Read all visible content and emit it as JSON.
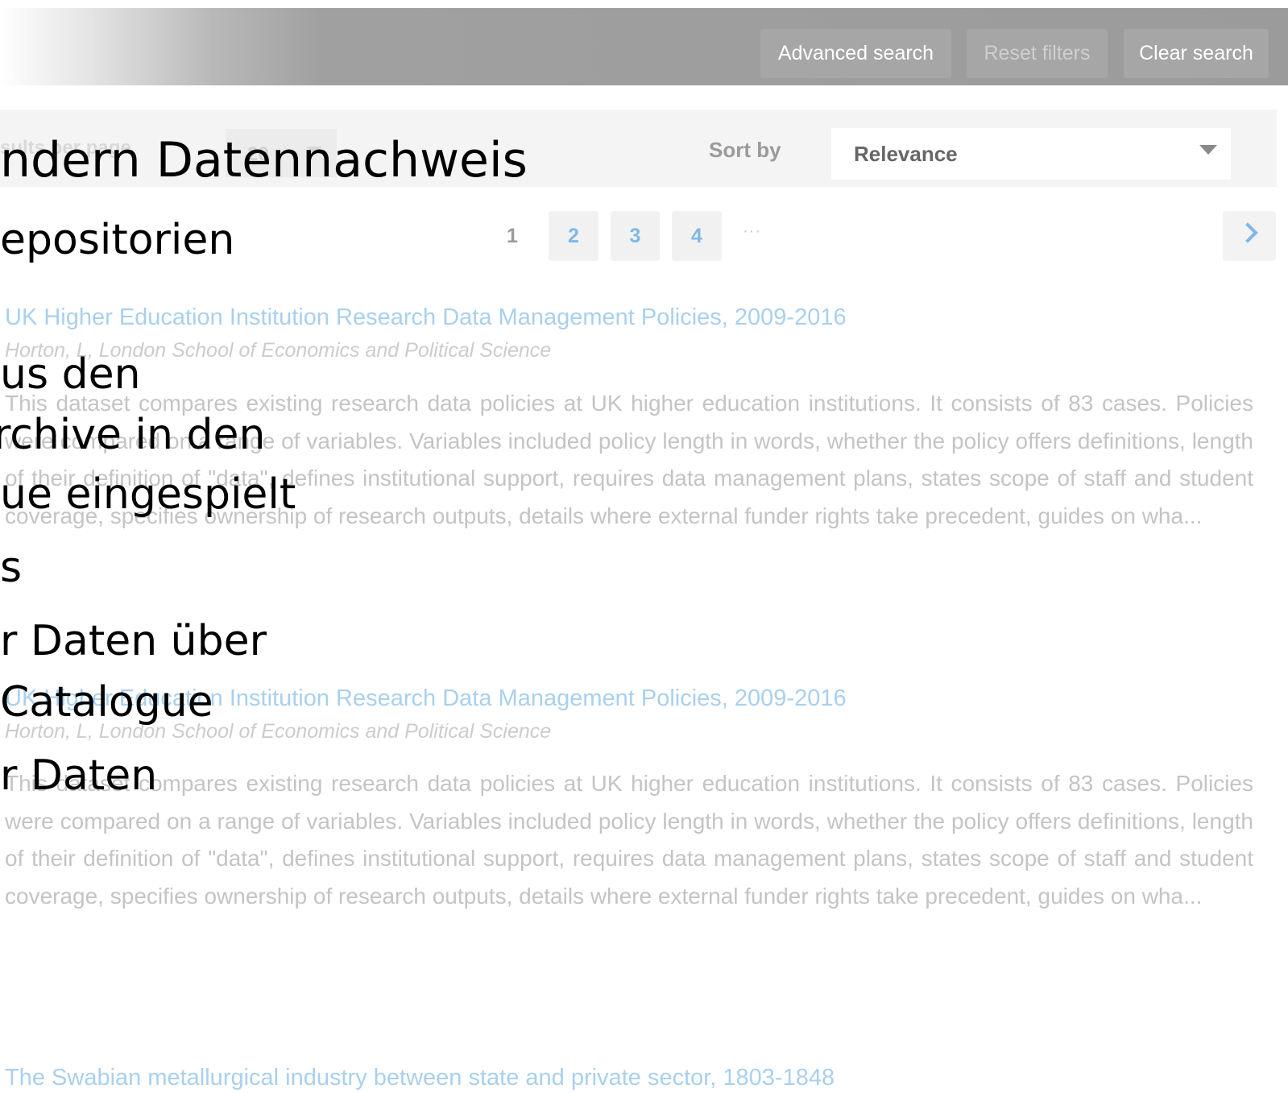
{
  "toolbar": {
    "advanced_search": "Advanced search",
    "reset_filters": "Reset filters",
    "clear_search": "Clear search"
  },
  "controls": {
    "results_per_page_label": "sults per page",
    "results_per_page_value": "20",
    "sort_by_label": "Sort by",
    "sort_by_value": "Relevance"
  },
  "pagination": {
    "pages": [
      "1",
      "2",
      "3",
      "4"
    ],
    "current": "1",
    "ellipsis": "···"
  },
  "results": [
    {
      "title": "UK Higher Education Institution Research Data Management Policies, 2009-2016",
      "author": "Horton, L, London School of Economics and Political Science",
      "description": "This dataset compares existing research data policies at UK higher education institutions. It consists of 83 cases. Policies were compared on a range of variables. Variables included policy length in words, whether the policy offers definitions, length of their definition of \"data\", defines institutional support, requires data management plans, states scope of staff and student coverage, specifies ownership of research outputs, details where external funder rights take precedent, guides on wha..."
    },
    {
      "title": "UK Higher Education Institution Research Data Management Policies, 2009-2016",
      "author": "Horton, L, London School of Economics and Political Science",
      "description": "This dataset compares existing research data policies at UK higher education institutions. It consists of 83 cases. Policies were compared on a range of variables. Variables included policy length in words, whether the policy offers definitions, length of their definition of \"data\", defines institutional support, requires data management plans, states scope of staff and student coverage, specifies ownership of research outputs, details where external funder rights take precedent, guides on wha..."
    },
    {
      "title": "The Swabian metallurgical industry between state and private sector, 1803-1848"
    }
  ],
  "overlay": {
    "line1": "ndern Datennachweis",
    "line2": "epositorien",
    "line3": "us den",
    "line4": "rchive in den",
    "line5": "ue eingespielt",
    "line6": "s",
    "line7": "r Daten über",
    "line8": " Catalogue",
    "line9": "r Daten"
  }
}
